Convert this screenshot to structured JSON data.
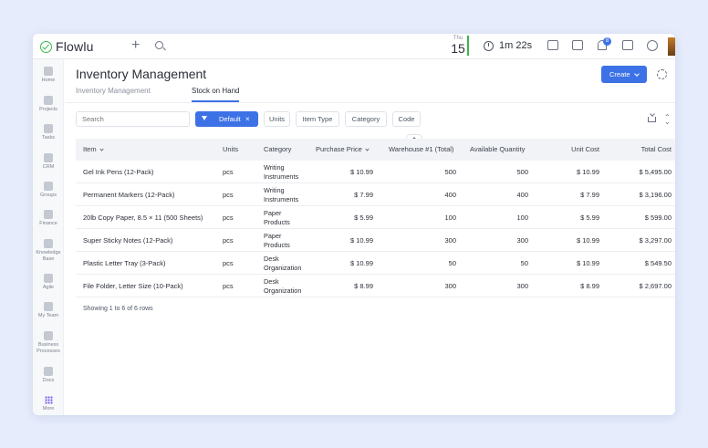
{
  "app": {
    "name": "Flowlu"
  },
  "topbar": {
    "date_dow": "Thu",
    "date_day": "15",
    "timer": "1m 22s",
    "notification_count": "8"
  },
  "sidebar": {
    "items": [
      {
        "label": "Home",
        "icon": "home-icon"
      },
      {
        "label": "Projects",
        "icon": "projects-icon"
      },
      {
        "label": "Tasks",
        "icon": "tasks-icon"
      },
      {
        "label": "CRM",
        "icon": "crm-icon"
      },
      {
        "label": "Groups",
        "icon": "groups-icon"
      },
      {
        "label": "Finance",
        "icon": "finance-icon"
      },
      {
        "label": "Knowledge Base",
        "icon": "knowledge-base-icon"
      },
      {
        "label": "Agile",
        "icon": "agile-icon"
      },
      {
        "label": "My Team",
        "icon": "my-team-icon"
      },
      {
        "label": "Business Processes",
        "icon": "business-processes-icon"
      },
      {
        "label": "Docs",
        "icon": "docs-icon"
      },
      {
        "label": "More",
        "icon": "more-grid-icon"
      }
    ]
  },
  "page": {
    "title": "Inventory Management",
    "tabs": [
      {
        "label": "Inventory Management",
        "active": false
      },
      {
        "label": "Stock on Hand",
        "active": true
      }
    ],
    "create_label": "Create"
  },
  "filters": {
    "search_placeholder": "Search",
    "active_filter": "Default",
    "chips": [
      "Units",
      "Item Type",
      "Category",
      "Code"
    ]
  },
  "table": {
    "columns": [
      "Item",
      "Units",
      "Category",
      "Purchase Price",
      "Warehouse #1 (Total)",
      "Available Quantity",
      "Unit Cost",
      "Total Cost"
    ],
    "rows": [
      {
        "item": "Gel Ink Pens (12-Pack)",
        "units": "pcs",
        "category": "Writing Instruments",
        "price": "$ 10.99",
        "warehouse": "500",
        "available": "500",
        "unit_cost": "$ 10.99",
        "total": "$ 5,495.00"
      },
      {
        "item": "Permanent Markers (12-Pack)",
        "units": "pcs",
        "category": "Writing Instruments",
        "price": "$ 7.99",
        "warehouse": "400",
        "available": "400",
        "unit_cost": "$ 7.99",
        "total": "$ 3,196.00"
      },
      {
        "item": "20lb Copy Paper, 8.5 × 11 (500 Sheets)",
        "units": "pcs",
        "category": "Paper Products",
        "price": "$ 5.99",
        "warehouse": "100",
        "available": "100",
        "unit_cost": "$ 5.99",
        "total": "$ 599.00"
      },
      {
        "item": "Super Sticky Notes (12-Pack)",
        "units": "pcs",
        "category": "Paper Products",
        "price": "$ 10.99",
        "warehouse": "300",
        "available": "300",
        "unit_cost": "$ 10.99",
        "total": "$ 3,297.00"
      },
      {
        "item": "Plastic Letter Tray (3-Pack)",
        "units": "pcs",
        "category": "Desk Organization",
        "price": "$ 10.99",
        "warehouse": "50",
        "available": "50",
        "unit_cost": "$ 10.99",
        "total": "$ 549.50"
      },
      {
        "item": "File Folder, Letter Size (10-Pack)",
        "units": "pcs",
        "category": "Desk Organization",
        "price": "$ 8.99",
        "warehouse": "300",
        "available": "300",
        "unit_cost": "$ 8.99",
        "total": "$ 2,697.00"
      }
    ],
    "footer": "Showing 1 to 6 of 6 rows"
  },
  "colors": {
    "accent": "#3d72e6",
    "brand_green": "#3bb54a"
  }
}
